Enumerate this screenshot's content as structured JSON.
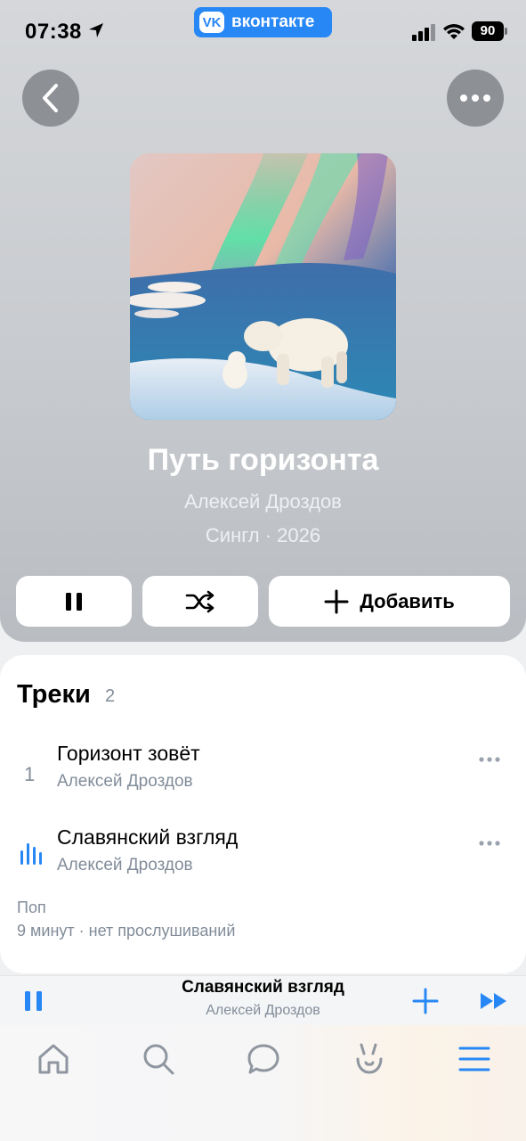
{
  "status_bar": {
    "time": "07:38",
    "app_pill_label": "вконтакте",
    "app_pill_logo": "VK",
    "battery": "90"
  },
  "header": {
    "back_icon": "chevron-left-icon",
    "more_icon": "more-horizontal-icon"
  },
  "album": {
    "title": "Путь горизонта",
    "artist": "Алексей Дроздов",
    "meta": "Сингл · 2026"
  },
  "controls": {
    "pause_icon": "pause-icon",
    "shuffle_icon": "shuffle-icon",
    "add_label": "Добавить"
  },
  "tracks": {
    "title": "Треки",
    "count": "2",
    "items": [
      {
        "number": "1",
        "title": "Горизонт зовёт",
        "artist": "Алексей Дроздов",
        "playing": false
      },
      {
        "number": "",
        "title": "Славянский взгляд",
        "artist": "Алексей Дроздов",
        "playing": true
      }
    ],
    "genre": "Поп",
    "duration": "9 минут · нет прослушиваний"
  },
  "mini_player": {
    "title": "Славянский взгляд",
    "artist": "Алексей Дроздов"
  },
  "tab_bar": {
    "items": [
      "home-icon",
      "search-icon",
      "messenger-icon",
      "clips-icon",
      "menu-icon"
    ]
  },
  "colors": {
    "accent": "#2787f5",
    "secondary_text": "#818c99"
  }
}
